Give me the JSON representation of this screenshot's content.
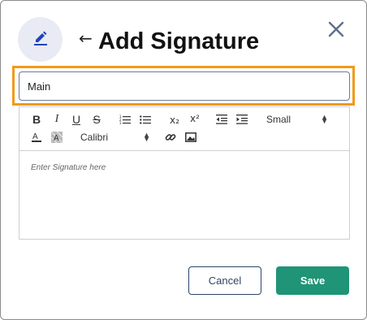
{
  "dialog": {
    "title": "Add Signature",
    "back_glyph": "←",
    "header_icon": "pen-icon",
    "close_icon": "close-icon"
  },
  "name_field": {
    "value": "Main"
  },
  "toolbar": {
    "bold": "B",
    "italic": "I",
    "underline": "U",
    "strike": "S",
    "subscript": "x₂",
    "superscript": "x²",
    "size_value": "Small",
    "font_value": "Calibri",
    "icons": [
      "bold-icon",
      "italic-icon",
      "underline-icon",
      "strikethrough-icon",
      "ordered-list-icon",
      "bullet-list-icon",
      "subscript-icon",
      "superscript-icon",
      "outdent-icon",
      "indent-icon",
      "font-color-icon",
      "highlight-color-icon",
      "link-icon",
      "image-icon"
    ]
  },
  "editor": {
    "placeholder": "Enter Signature here"
  },
  "footer": {
    "cancel_label": "Cancel",
    "save_label": "Save"
  },
  "colors": {
    "highlight": "#f09a1a",
    "primary": "#1f9476",
    "navy": "#2f4466",
    "icon_bg": "#e8ebf3",
    "pen": "#2443b8"
  }
}
